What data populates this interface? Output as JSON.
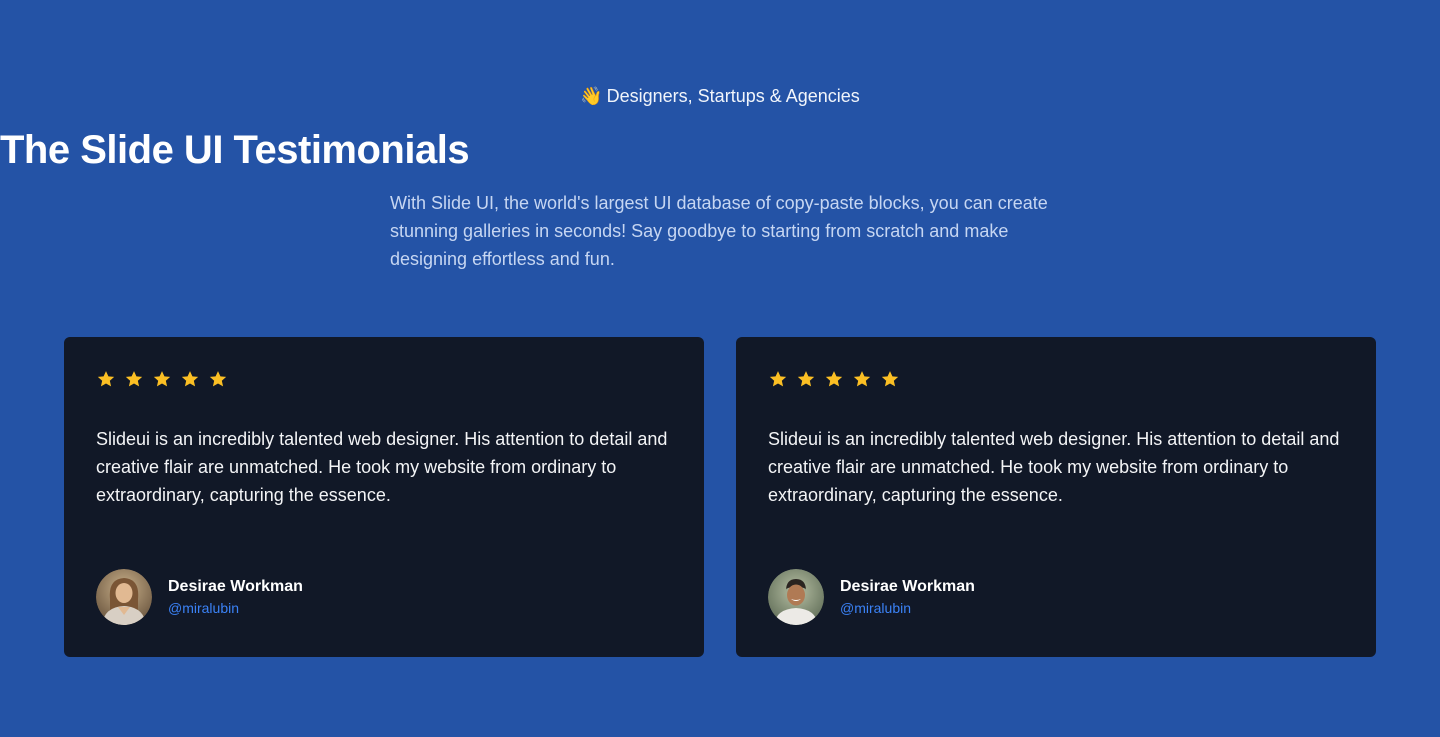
{
  "header": {
    "eyebrow_icon": "waving-hand-icon",
    "eyebrow_emoji": "👋",
    "eyebrow": "Designers, Startups & Agencies",
    "title": "The Slide UI Testimonials",
    "subtitle": "With Slide UI, the world's largest UI database of copy-paste blocks, you can create stunning galleries in seconds! Say goodbye to starting from scratch and make designing effortless and fun."
  },
  "colors": {
    "background": "#2453a6",
    "card": "#111827",
    "star": "#fbbf24",
    "handle": "#3b82f6"
  },
  "testimonials": [
    {
      "rating": 5,
      "quote": "Slideui is an incredibly talented web designer. His attention to detail and creative flair are unmatched. He took my website from ordinary to extraordinary, capturing the essence.",
      "name": "Desirae Workman",
      "handle": "@miralubin"
    },
    {
      "rating": 5,
      "quote": "Slideui is an incredibly talented web designer. His attention to detail and creative flair are unmatched. He took my website from ordinary to extraordinary, capturing the essence.",
      "name": "Desirae Workman",
      "handle": "@miralubin"
    }
  ]
}
